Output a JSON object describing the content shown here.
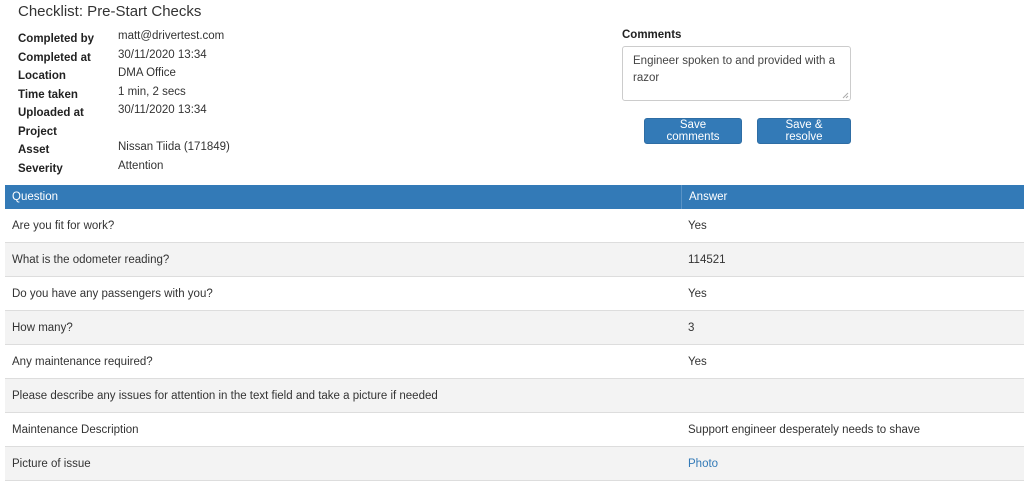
{
  "page": {
    "title": "Checklist: Pre-Start Checks"
  },
  "details": [
    {
      "label": "Completed by",
      "value": "matt@drivertest.com"
    },
    {
      "label": "Completed at",
      "value": "30/11/2020 13:34"
    },
    {
      "label": "Location",
      "value": "DMA Office"
    },
    {
      "label": "Time taken",
      "value": "1 min, 2 secs"
    },
    {
      "label": "Uploaded at",
      "value": "30/11/2020 13:34"
    },
    {
      "label": "Project",
      "value": ""
    },
    {
      "label": "Asset",
      "value": "Nissan Tiida (171849)"
    },
    {
      "label": "Severity",
      "value": "Attention"
    }
  ],
  "comments": {
    "label": "Comments",
    "value": "Engineer spoken to and provided with a razor",
    "save_label": "Save comments",
    "resolve_label": "Save & resolve"
  },
  "table": {
    "headers": {
      "question": "Question",
      "answer": "Answer"
    },
    "rows": [
      {
        "question": "Are you fit for work?",
        "answer": "Yes"
      },
      {
        "question": "What is the odometer reading?",
        "answer": "114521"
      },
      {
        "question": "Do you have any passengers with you?",
        "answer": "Yes"
      },
      {
        "question": "How many?",
        "answer": "3"
      },
      {
        "question": "Any maintenance required?",
        "answer": "Yes"
      },
      {
        "question": "Please describe any issues for attention in the text field and take a picture if needed",
        "answer": ""
      },
      {
        "question": "Maintenance Description",
        "answer": "Support engineer desperately needs to shave"
      },
      {
        "question": "Picture of issue",
        "answer": "Photo",
        "answer_is_link": true
      }
    ]
  },
  "colors": {
    "primary": "#337ab7",
    "row_alt": "#f3f3f3",
    "link": "#337ab7"
  }
}
